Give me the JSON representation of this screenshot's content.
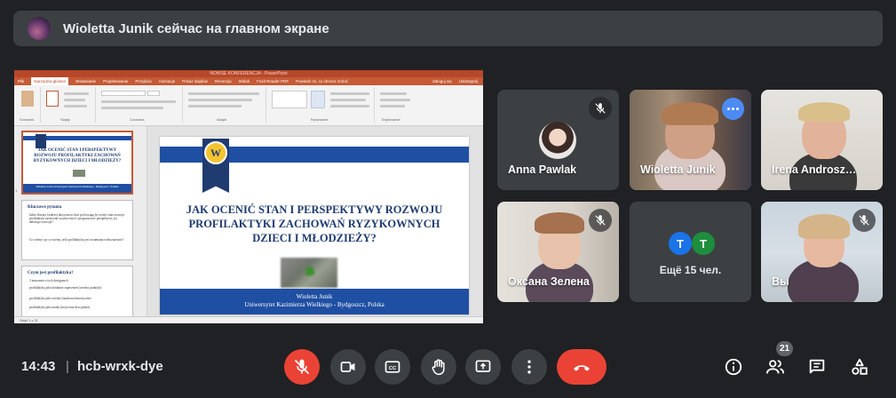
{
  "banner": {
    "text": "Wioletta Junik сейчас на главном экране"
  },
  "presentation": {
    "window_title": "NOWSE KONFERENCJA - PowerPoint",
    "tabs": [
      "Plik",
      "Narzędzia główne",
      "Wstawianie",
      "Projektowanie",
      "Przejścia",
      "Animacje",
      "Pokaz slajdów",
      "Recenzja",
      "Widok",
      "Foxit Reader PDF",
      "Powiedz mi, co chcesz zrobić"
    ],
    "tabs_right": [
      "Zaloguj się",
      "Udostępnij"
    ],
    "ribbon_groups": [
      "Schowek",
      "Slajdy",
      "Czcionka",
      "Akapit",
      "Rysowanie",
      "Edytowanie"
    ],
    "status": "Slajd 1 z 21",
    "thumb1": {
      "title": "JAK OCENIĆ STAN I PERSPEKTYWY ROZWOJU PROFILAKTYKI ZACHOWAŃ RYZYKOWNYCH DZIECI I MŁODZIEŻY?",
      "footer": "Wioletta Junik Uniwersytet Kazimierza Wielkiego - Bydgoszcz, Polska"
    },
    "thumb2": {
      "heading": "Kluczowe pytania",
      "lines": [
        "Jakie obszary (zakres) aktywności brać pod uwagę by ocenić stan rozwoju profilaktyki zachowań ryzykownych i prognozować perspektywy jej dalszego rozwoju?",
        "Co wiemy/ po co wiemy, jeśli profilaktyka jest rozumiana wieloznacznie?"
      ]
    },
    "thumb3": {
      "heading": "Czym jest profilaktyka?",
      "lines": [
        "3 znaczenia z tych dostępnych",
        "profilaktyka jako działanie zapewnień (wiedzy praktyki)",
        "profilaktyka jako wiedza (naukowa/teoretyczna)",
        "profilaktyka jako nauka (krytyczna dyscyplina)"
      ]
    },
    "slide": {
      "title": "JAK OCENIĆ STAN I PERSPEKTYWY ROZWOJU PROFILAKTYKI ZACHOWAŃ RYZYKOWNYCH DZIECI I MŁODZIEŻY?",
      "author": "Wioletta Junik",
      "affiliation": "Uniwersytet Kazimierza Wielkiego - Bydgoszcz, Polska"
    }
  },
  "participants": [
    {
      "name": "Anna Pawlak",
      "muted": true
    },
    {
      "name": "Wioletta Junik",
      "muted": false,
      "speaking": true
    },
    {
      "name": "Irena Androsz…",
      "muted": false
    },
    {
      "name": "Оксана Зелена",
      "muted": true
    },
    {
      "name": "Вы",
      "muted": true
    }
  ],
  "more_tile": {
    "initials": [
      "Т",
      "Т"
    ],
    "text": "Ещё 15 чел.",
    "colors": [
      "#1a73e8",
      "#1e8e3e"
    ]
  },
  "bottom_bar": {
    "time": "14:43",
    "separator": "|",
    "meeting_code": "hcb-wrxk-dye",
    "people_count": "21"
  },
  "colors": {
    "end_call": "#ea4335",
    "bg": "#202124",
    "tile": "#3c4043",
    "accent": "#8ab4f8"
  },
  "icons": [
    "mic-off-icon",
    "camera-icon",
    "captions-icon",
    "raise-hand-icon",
    "present-icon",
    "more-vert-icon",
    "end-call-icon",
    "info-icon",
    "people-icon",
    "chat-icon",
    "activities-icon"
  ]
}
